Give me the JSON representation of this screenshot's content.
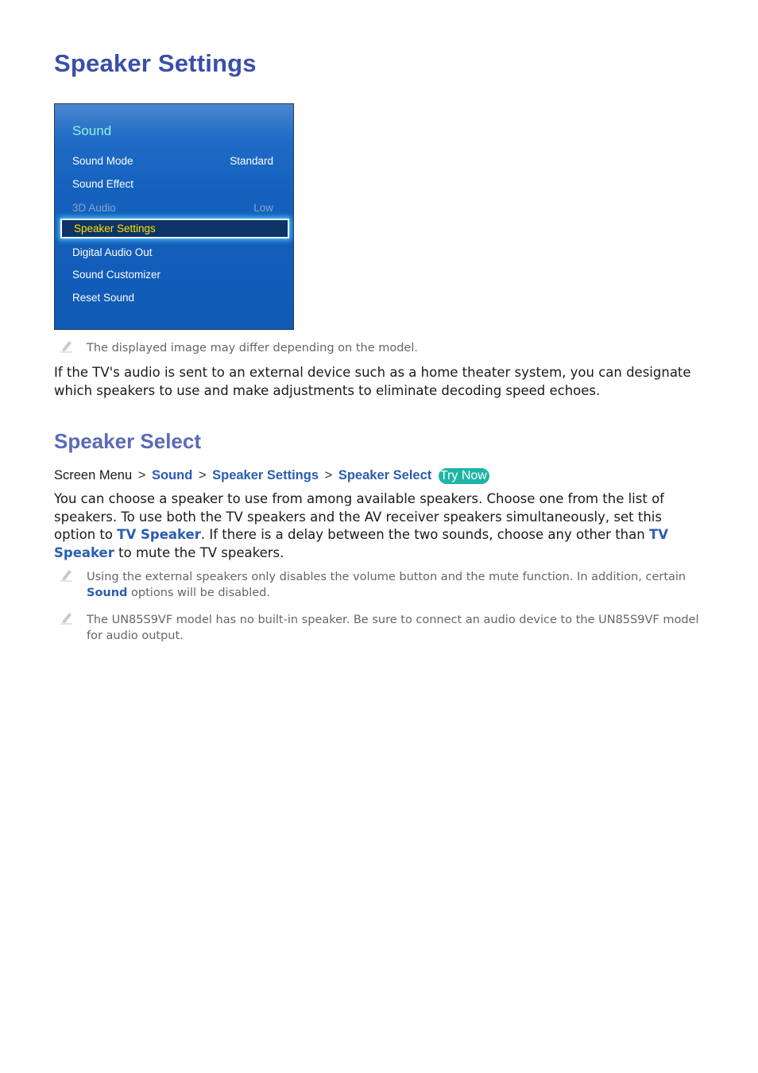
{
  "page": {
    "title": "Speaker Settings"
  },
  "tv_menu": {
    "title": "Sound",
    "items": [
      {
        "label": "Sound Mode",
        "value": "Standard",
        "state": "normal"
      },
      {
        "label": "Sound Effect",
        "value": "",
        "state": "normal"
      },
      {
        "label": "3D Audio",
        "value": "Low",
        "state": "disabled"
      },
      {
        "label": "Speaker Settings",
        "value": "",
        "state": "selected"
      },
      {
        "label": "Digital Audio Out",
        "value": "",
        "state": "normal"
      },
      {
        "label": "Sound Customizer",
        "value": "",
        "state": "normal"
      },
      {
        "label": "Reset Sound",
        "value": "",
        "state": "normal"
      }
    ]
  },
  "image_note": "The displayed image may differ depending on the model.",
  "intro": {
    "line1": "If the TV's audio is sent to an external device such as a home theater system, you can designate",
    "line2": "which speakers to use and make adjustments to eliminate decoding speed echoes."
  },
  "speaker_select": {
    "title": "Speaker Select",
    "breadcrumb": {
      "root": "Screen Menu",
      "separator": ">",
      "links": [
        "Sound",
        "Speaker Settings",
        "Speaker Select"
      ],
      "try_now": "Try Now"
    },
    "description": {
      "part1": "You can choose a speaker to use from among available speakers. Choose one from the list of speakers. To use both the TV speakers and the AV receiver speakers simultaneously, set this option to ",
      "link1": "TV Speaker",
      "part2": ". If there is a delay between the two sounds, choose any other than ",
      "link2": "TV Speaker",
      "part3": " to mute the TV speakers."
    },
    "notes": [
      {
        "text_before": "Using the external speakers only disables the volume button and the mute function. In addition, certain ",
        "link": "Sound",
        "text_after": " options will be disabled."
      },
      {
        "text": "The UN85S9VF model has no built-in speaker. Be sure to connect an audio device to the UN85S9VF model for audio output."
      }
    ]
  },
  "colors": {
    "title": "#3a4fa8",
    "section_title": "#5b6ab8",
    "link": "#2a5db0",
    "try_now": "#1fb5a6",
    "menu_selected_text": "#ffe100",
    "menu_title": "#8cf2dc"
  }
}
